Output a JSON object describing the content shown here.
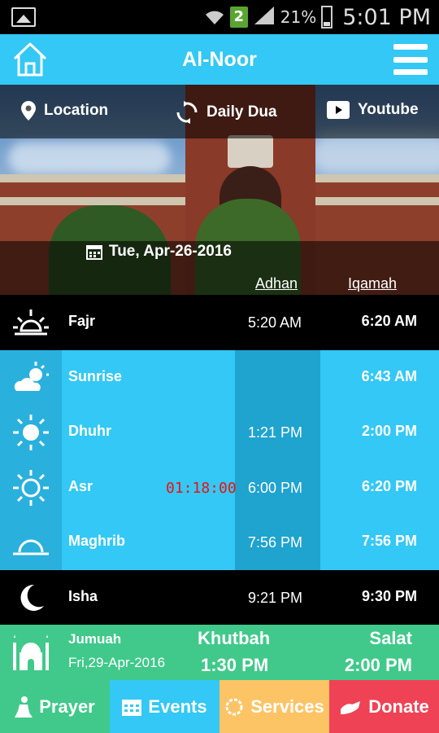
{
  "status_bar": {
    "battery_pct": "21%",
    "time": "5:01 PM",
    "sim_badge": "2"
  },
  "app": {
    "title": "Al-Noor"
  },
  "nav": {
    "location": "Location",
    "daily_dua": "Daily Dua",
    "youtube": "Youtube"
  },
  "date": "Tue, Apr-26-2016",
  "columns": {
    "adhan": "Adhan",
    "iqamah": "Iqamah"
  },
  "prayers": [
    {
      "name": "Fajr",
      "adhan": "5:20 AM",
      "iqamah": "6:20 AM",
      "icon": "sunrise-horizon-icon"
    },
    {
      "name": "Sunrise",
      "adhan": "",
      "iqamah": "6:43 AM",
      "icon": "cloud-sun-icon"
    },
    {
      "name": "Dhuhr",
      "adhan": "1:21 PM",
      "iqamah": "2:00 PM",
      "icon": "sun-icon"
    },
    {
      "name": "Asr",
      "adhan": "6:00 PM",
      "iqamah": "6:20 PM",
      "icon": "sun-outline-icon",
      "countdown": "01:18:00"
    },
    {
      "name": "Maghrib",
      "adhan": "7:56 PM",
      "iqamah": "7:56 PM",
      "icon": "sunset-icon"
    },
    {
      "name": "Isha",
      "adhan": "9:21 PM",
      "iqamah": "9:30 PM",
      "icon": "crescent-moon-icon"
    }
  ],
  "jumuah": {
    "title": "Jumuah",
    "date": "Fri,29-Apr-2016",
    "khutbah_label": "Khutbah",
    "khutbah_time": "1:30 PM",
    "salat_label": "Salat",
    "salat_time": "2:00 PM"
  },
  "tabs": {
    "prayer": "Prayer",
    "events": "Events",
    "services": "Services",
    "donate": "Donate"
  },
  "colors": {
    "header_blue": "#33c8f5",
    "green": "#40c98a",
    "orange": "#fdc466",
    "red": "#f04255",
    "countdown_red": "#e11111"
  }
}
